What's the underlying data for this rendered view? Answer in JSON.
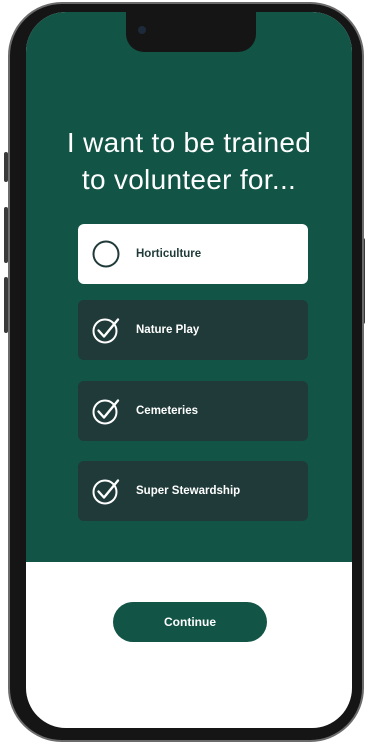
{
  "heading": {
    "line1": "I want to be trained",
    "line2": "to volunteer for..."
  },
  "options": [
    {
      "label": "Horticulture",
      "selected": false,
      "icon": "empty-circle-icon"
    },
    {
      "label": "Nature Play",
      "selected": true,
      "icon": "check-circle-icon"
    },
    {
      "label": "Cemeteries",
      "selected": true,
      "icon": "check-circle-icon"
    },
    {
      "label": "Super Stewardship",
      "selected": true,
      "icon": "check-circle-icon"
    }
  ],
  "continue_button": {
    "label": "Continue"
  },
  "colors": {
    "brand_green": "#125446",
    "selected_card": "#1f3a38",
    "unselected_card": "#ffffff"
  }
}
